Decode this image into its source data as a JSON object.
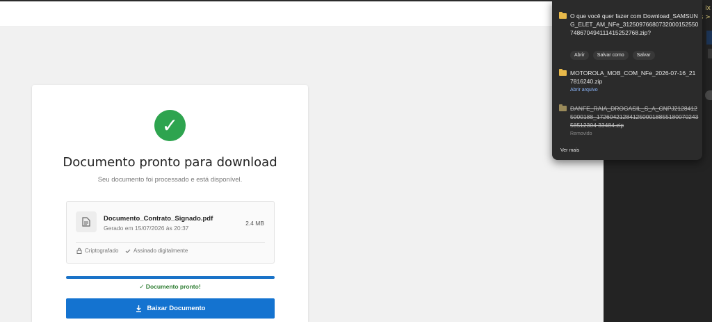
{
  "downloads_popup": {
    "items": [
      {
        "text": "O que você quer fazer com Download_SAMSUNG_ELET_AM_NFe_31250976680732000152550748670494111415252768.zip?",
        "actions": [
          "Abrir",
          "Salvar como",
          "Salvar"
        ]
      },
      {
        "text": "MOTOROLA_MOB_COM_NFe_2026-07-16_217816240.zip",
        "sub": "Abrir arquivo"
      },
      {
        "text": "DANFE_RAIA_DROGASIL_S_A_CNPJ21284125000188_172604212841250001885518007024358512304 33484.zip",
        "sub": "Removido"
      }
    ],
    "see_more": "Ver mais"
  },
  "card": {
    "title": "Documento pronto para download",
    "subtitle": "Seu documento foi processado e está disponível.",
    "file": {
      "name": "Documento_Contrato_Signado.pdf",
      "date": "Gerado em 15/07/2026 às 20:37",
      "size": "2.4 MB",
      "tags": [
        "Criptografado",
        "Assinado digitalmente"
      ]
    },
    "progress": 100,
    "ready_text": "✓ Documento pronto!",
    "download_button": "Baixar Documento"
  },
  "side_peek_text": "ix\ns >",
  "colors": {
    "accent": "#1473d0",
    "success": "#2ea44f",
    "popup_bg": "#2b2b2b"
  }
}
